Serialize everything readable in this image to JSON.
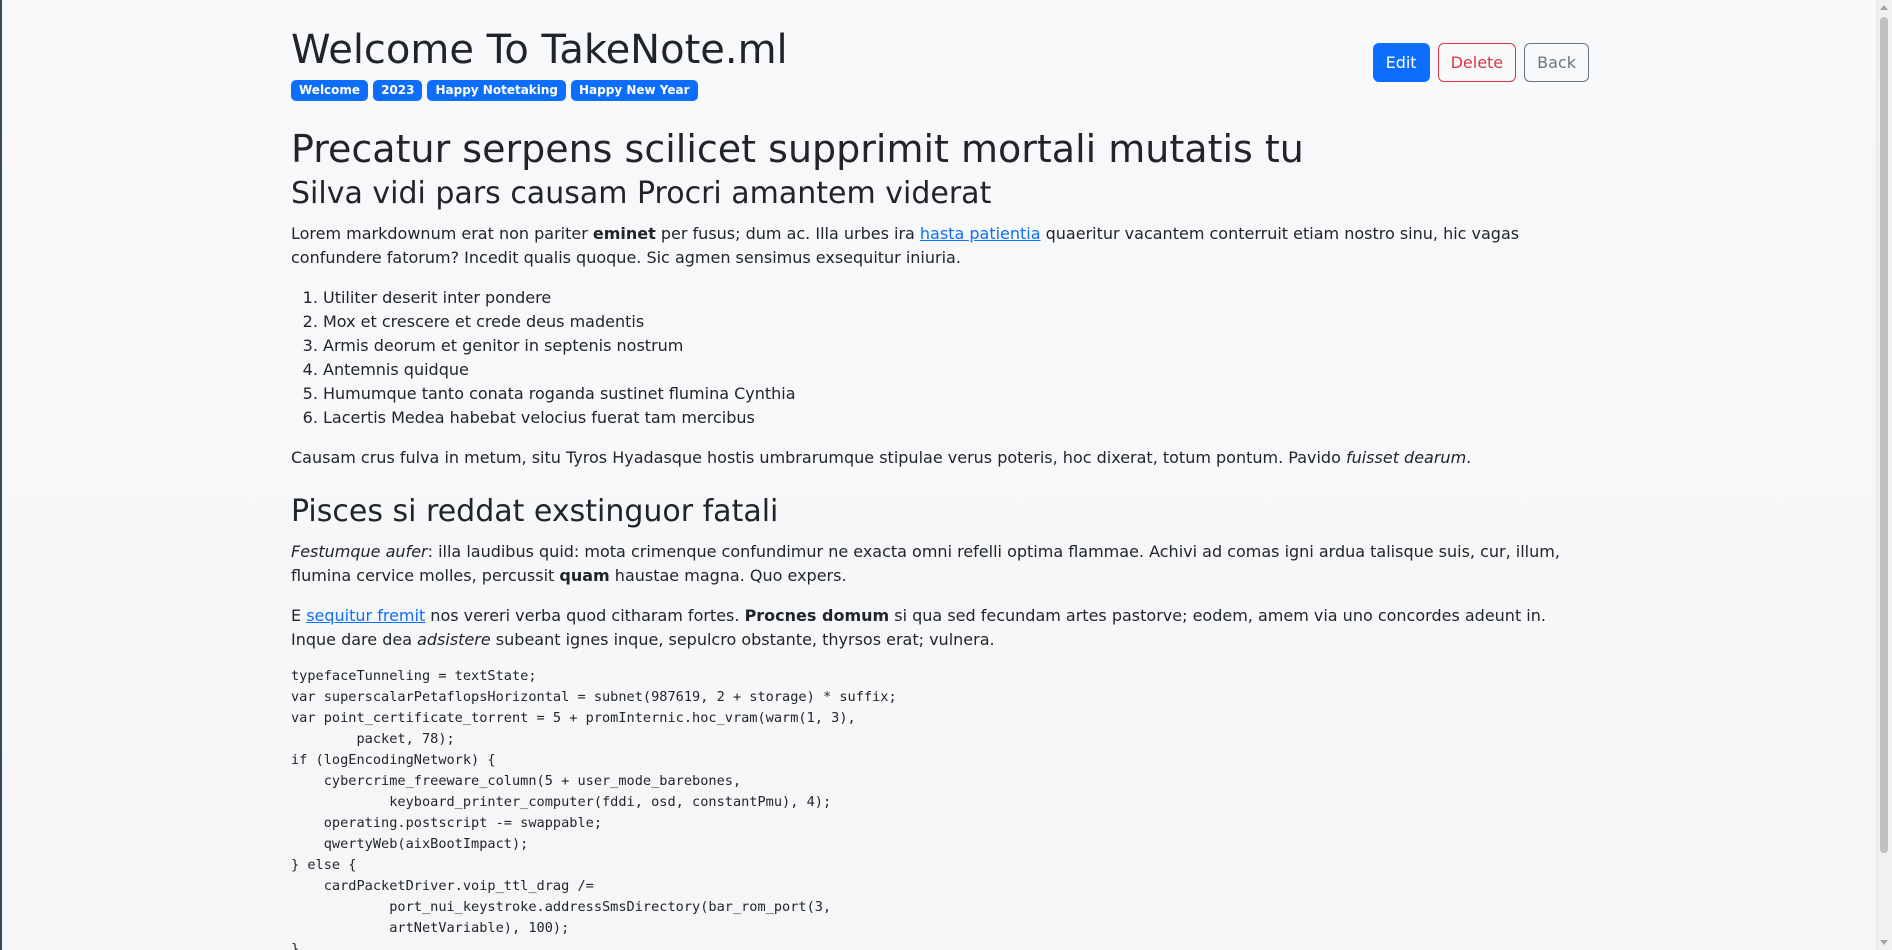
{
  "note": {
    "title": "Welcome To TakeNote.ml",
    "tags": [
      "Welcome",
      "2023",
      "Happy Notetaking",
      "Happy New Year"
    ]
  },
  "actions": {
    "edit_label": "Edit",
    "delete_label": "Delete",
    "back_label": "Back"
  },
  "content": {
    "h1": "Precatur serpens scilicet supprimit mortali mutatis tu",
    "h2_first": "Silva vidi pars causam Procri amantem viderat",
    "p1": {
      "t1": "Lorem markdownum erat non pariter ",
      "b1": "eminet",
      "t2": " per fusus; dum ac. Illa urbes ira ",
      "link1": "hasta patientia",
      "t3": " quaeritur vacantem conterruit etiam nostro sinu, hic vagas confundere fatorum? Incedit qualis quoque. Sic agmen sensimus exsequitur iniuria."
    },
    "list": [
      "Utiliter deserit inter pondere",
      "Mox et crescere et crede deus madentis",
      "Armis deorum et genitor in septenis nostrum",
      "Antemnis quidque",
      "Humumque tanto conata roganda sustinet flumina Cynthia",
      "Lacertis Medea habebat velocius fuerat tam mercibus"
    ],
    "p2": {
      "t1": "Causam crus fulva in metum, situ Tyros Hyadasque hostis umbrarumque stipulae verus poteris, hoc dixerat, totum pontum. Pavido ",
      "i1": "fuisset dearum",
      "t2": "."
    },
    "h2_second": "Pisces si reddat exstinguor fatali",
    "p3": {
      "i1": "Festumque aufer",
      "t1": ": illa laudibus quid: mota crimenque confundimur ne exacta omni refelli optima flammae. Achivi ad comas igni ardua talisque suis, cur, illum, flumina cervice molles, percussit ",
      "b1": "quam",
      "t2": " haustae magna. Quo expers."
    },
    "p4": {
      "t1": "E ",
      "link1": "sequitur fremit",
      "t2": " nos vereri verba quod citharam fortes. ",
      "b1": "Procnes domum",
      "t3": " si qua sed fecundam artes pastorve; eodem, amem via uno concordes adeunt in. Inque dare dea ",
      "i1": "adsistere",
      "t4": " subeant ignes inque, sepulcro obstante, thyrsos erat; vulnera."
    },
    "code": "typefaceTunneling = textState;\nvar superscalarPetaflopsHorizontal = subnet(987619, 2 + storage) * suffix;\nvar point_certificate_torrent = 5 + promInternic.hoc_vram(warm(1, 3),\n        packet, 78);\nif (logEncodingNetwork) {\n    cybercrime_freeware_column(5 + user_mode_barebones,\n            keyboard_printer_computer(fddi, osd, constantPmu), 4);\n    operating.postscript -= swappable;\n    qwertyWeb(aixBootImpact);\n} else {\n    cardPacketDriver.voip_ttl_drag /=\n            port_nui_keystroke.addressSmsDirectory(bar_rom_port(3,\n            artNetVariable), 100);\n}"
  }
}
